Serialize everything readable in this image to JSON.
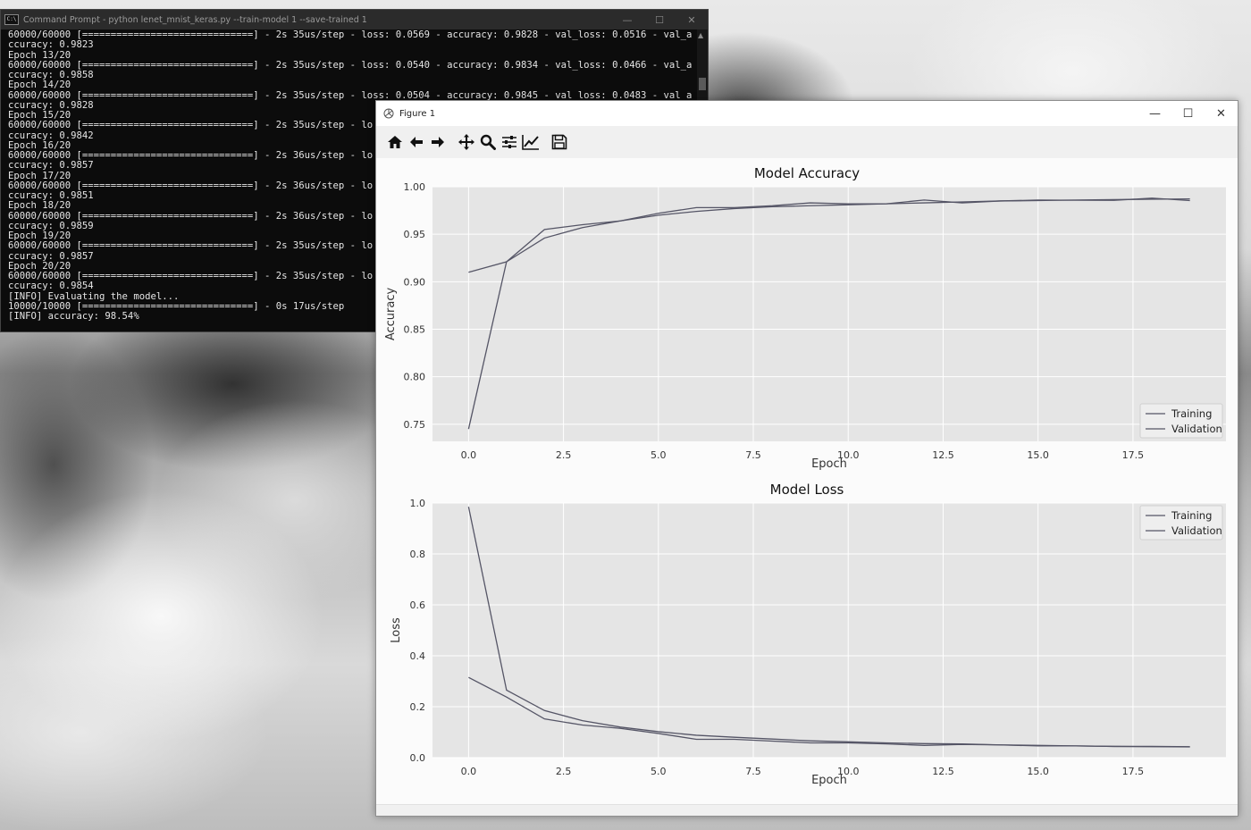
{
  "cmd": {
    "title": "Command Prompt - python  lenet_mnist_keras.py --train-model 1 --save-trained 1",
    "icon": "cmd-icon",
    "lines": [
      "60000/60000 [==============================] - 2s 35us/step - loss: 0.0569 - accuracy: 0.9828 - val_loss: 0.0516 - val_a",
      "ccuracy: 0.9823",
      "Epoch 13/20",
      "60000/60000 [==============================] - 2s 35us/step - loss: 0.0540 - accuracy: 0.9834 - val_loss: 0.0466 - val_a",
      "ccuracy: 0.9858",
      "Epoch 14/20",
      "60000/60000 [==============================] - 2s 35us/step - loss: 0.0504 - accuracy: 0.9845 - val_loss: 0.0483 - val_a",
      "ccuracy: 0.9828",
      "Epoch 15/20",
      "60000/60000 [==============================] - 2s 35us/step - lo",
      "ccuracy: 0.9842",
      "Epoch 16/20",
      "60000/60000 [==============================] - 2s 36us/step - lo",
      "ccuracy: 0.9857",
      "Epoch 17/20",
      "60000/60000 [==============================] - 2s 36us/step - lo",
      "ccuracy: 0.9851",
      "Epoch 18/20",
      "60000/60000 [==============================] - 2s 36us/step - lo",
      "ccuracy: 0.9859",
      "Epoch 19/20",
      "60000/60000 [==============================] - 2s 35us/step - lo",
      "ccuracy: 0.9857",
      "Epoch 20/20",
      "60000/60000 [==============================] - 2s 35us/step - lo",
      "ccuracy: 0.9854",
      "[INFO] Evaluating the model...",
      "10000/10000 [==============================] - 0s 17us/step",
      "[INFO] accuracy: 98.54%"
    ]
  },
  "figure": {
    "title": "Figure 1",
    "toolbar": [
      {
        "name": "home-icon",
        "label": "Home"
      },
      {
        "name": "back-arrow-icon",
        "label": "Back"
      },
      {
        "name": "forward-arrow-icon",
        "label": "Forward"
      },
      {
        "name": "pan-icon",
        "label": "Pan"
      },
      {
        "name": "zoom-icon",
        "label": "Zoom"
      },
      {
        "name": "subplots-icon",
        "label": "Configure subplots"
      },
      {
        "name": "edit-curves-icon",
        "label": "Edit axis, curve and image parameters"
      },
      {
        "name": "save-icon",
        "label": "Save"
      }
    ]
  },
  "colors": {
    "plot_bg": "#e5e5e5",
    "grid": "#ffffff",
    "line": "#555566",
    "figure_bg": "#fbfbfb"
  },
  "chart_data": [
    {
      "type": "line",
      "title": "Model Accuracy",
      "xlabel": "Epoch",
      "ylabel": "Accuracy",
      "xlim": [
        -0.95,
        19.95
      ],
      "ylim": [
        0.732,
        1.0
      ],
      "xticks": [
        "0.0",
        "2.5",
        "5.0",
        "7.5",
        "10.0",
        "12.5",
        "15.0",
        "17.5"
      ],
      "yticks": [
        "0.75",
        "0.80",
        "0.85",
        "0.90",
        "0.95",
        "1.00"
      ],
      "x": [
        0,
        1,
        2,
        3,
        4,
        5,
        6,
        7,
        8,
        9,
        10,
        11,
        12,
        13,
        14,
        15,
        16,
        17,
        18,
        19
      ],
      "series": [
        {
          "name": "Training",
          "values": [
            0.745,
            0.921,
            0.946,
            0.957,
            0.964,
            0.97,
            0.974,
            0.977,
            0.979,
            0.98,
            0.981,
            0.982,
            0.983,
            0.984,
            0.985,
            0.9854,
            0.986,
            0.9865,
            0.9868,
            0.9872
          ]
        },
        {
          "name": "Validation",
          "values": [
            0.91,
            0.921,
            0.955,
            0.96,
            0.964,
            0.972,
            0.978,
            0.978,
            0.98,
            0.983,
            0.982,
            0.982,
            0.986,
            0.983,
            0.985,
            0.986,
            0.9858,
            0.9857,
            0.988,
            0.9854
          ]
        }
      ],
      "legend": "lower-right",
      "grid": true
    },
    {
      "type": "line",
      "title": "Model Loss",
      "xlabel": "Epoch",
      "ylabel": "Loss",
      "xlim": [
        -0.95,
        19.95
      ],
      "ylim": [
        0.0,
        1.0
      ],
      "xticks": [
        "0.0",
        "2.5",
        "5.0",
        "7.5",
        "10.0",
        "12.5",
        "15.0",
        "17.5"
      ],
      "yticks": [
        "0.0",
        "0.2",
        "0.4",
        "0.6",
        "0.8",
        "1.0"
      ],
      "x": [
        0,
        1,
        2,
        3,
        4,
        5,
        6,
        7,
        8,
        9,
        10,
        11,
        12,
        13,
        14,
        15,
        16,
        17,
        18,
        19
      ],
      "series": [
        {
          "name": "Training",
          "values": [
            0.985,
            0.265,
            0.185,
            0.145,
            0.12,
            0.102,
            0.088,
            0.08,
            0.073,
            0.066,
            0.062,
            0.058,
            0.055,
            0.054,
            0.05,
            0.048,
            0.046,
            0.044,
            0.043,
            0.042
          ]
        },
        {
          "name": "Validation",
          "values": [
            0.315,
            0.238,
            0.152,
            0.128,
            0.115,
            0.095,
            0.072,
            0.072,
            0.065,
            0.058,
            0.058,
            0.054,
            0.048,
            0.052,
            0.05,
            0.046,
            0.046,
            0.044,
            0.044,
            0.043
          ]
        }
      ],
      "legend": "upper-right",
      "grid": true
    }
  ]
}
